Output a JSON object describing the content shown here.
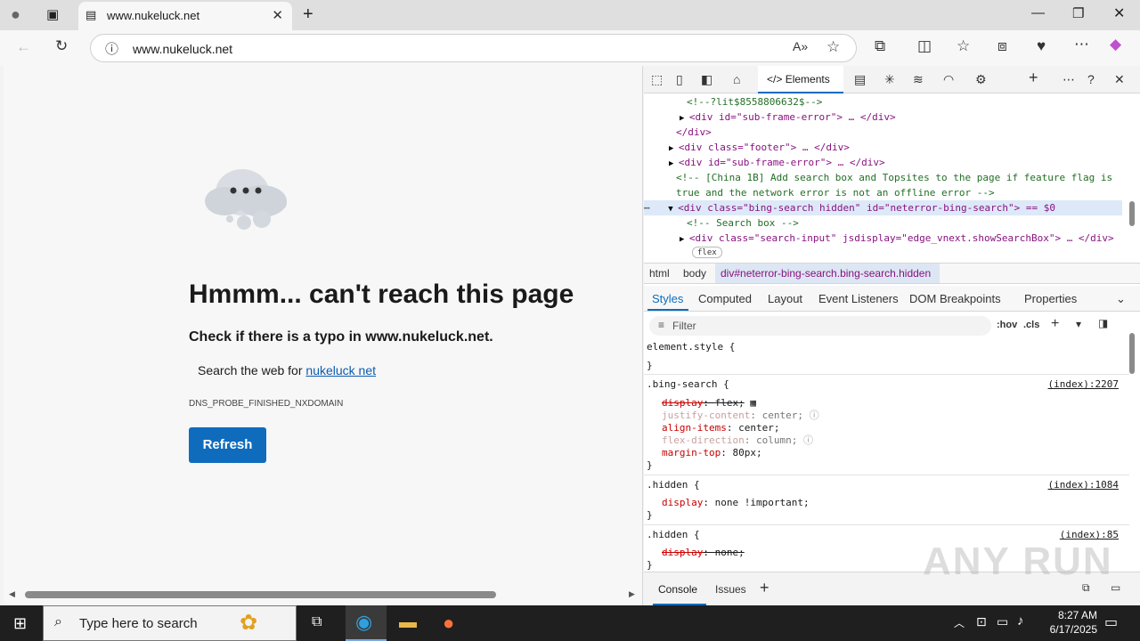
{
  "browser": {
    "tab_title": "www.nukeluck.net",
    "address": "www.nukeluck.net",
    "accent": "#0f6cbd"
  },
  "page": {
    "title": "Hmmm... can't reach this page",
    "check_text": "Check if there is a typo in www.nukeluck.net.",
    "search_prefix": "Search the web for",
    "search_link": "nukeluck net",
    "error_code": "DNS_PROBE_FINISHED_NXDOMAIN",
    "refresh_label": "Refresh"
  },
  "devtools": {
    "active_tab": "Elements",
    "dom_lines": [
      "<!--?lit$8558806632$-->",
      "<div id=\"sub-frame-error\"> … </div>",
      "</div>",
      "<div class=\"footer\"> … </div>",
      "<div id=\"sub-frame-error\"> … </div>",
      "<!-- [China 1B] Add search box and Topsites to the page if feature flag is",
      "true and the network error is not an offline error -->",
      "<div class=\"bing-search hidden\" id=\"neterror-bing-search\"> == $0",
      "<!-- Search box -->",
      "<div class=\"search-input\" jsdisplay=\"edge_vnext.showSearchBox\"> … </div>",
      "flex"
    ],
    "breadcrumbs": [
      "html",
      "body",
      "div#neterror-bing-search.bing-search.hidden"
    ],
    "subtabs": [
      "Styles",
      "Computed",
      "Layout",
      "Event Listeners",
      "DOM Breakpoints",
      "Properties"
    ],
    "filter_placeholder": "Filter",
    "filter_tools": [
      ":hov",
      ".cls"
    ],
    "rules": {
      "element_style": "element.style {",
      "close": "}",
      "bing_selector": ".bing-search {",
      "bing_src": "(index):2207",
      "bing_props": [
        {
          "name": "display",
          "value": "flex;"
        },
        {
          "name": "justify-content",
          "value": "center;"
        },
        {
          "name": "align-items",
          "value": "center;"
        },
        {
          "name": "flex-direction",
          "value": "column;"
        },
        {
          "name": "margin-top",
          "value": "80px;"
        }
      ],
      "hidden1_selector": ".hidden {",
      "hidden1_src": "(index):1084",
      "hidden1_prop": {
        "name": "display",
        "value": "none !important;"
      },
      "hidden2_selector": ".hidden {",
      "hidden2_src": "(index):85",
      "hidden2_prop": {
        "name": "display",
        "value": "none;"
      }
    },
    "drawer_tabs": [
      "Console",
      "Issues"
    ]
  },
  "taskbar": {
    "search_placeholder": "Type here to search",
    "time": "8:27 AM",
    "date": "6/17/2025"
  },
  "watermark": "ANY RUN"
}
